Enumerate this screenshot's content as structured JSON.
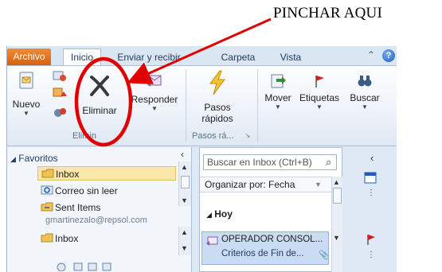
{
  "annotation": {
    "text": "PINCHAR AQUI"
  },
  "tabs": {
    "file": "Archivo",
    "home": "Inicio",
    "send_receive": "Enviar y recibir",
    "folder": "Carpeta",
    "view": "Vista",
    "help": "?"
  },
  "ribbon": {
    "new_label": "Nuevo",
    "delete_label": "Eliminar",
    "reply_label": "Responder",
    "quicksteps_label1": "Pasos",
    "quicksteps_label2": "rápidos",
    "move_label": "Mover",
    "tags_label": "Etiquetas",
    "search_label": "Buscar",
    "group_delete": "Elimin",
    "group_quicksteps": "Pasos rá..."
  },
  "nav": {
    "favorites": "Favoritos",
    "items": [
      "Inbox",
      "Correo sin leer",
      "Sent Items",
      "Inbox"
    ],
    "account": "gmartinezalo@repsol.com"
  },
  "mail": {
    "search_placeholder": "Buscar en Inbox (Ctrl+B)",
    "arrange": "Organizar por: Fecha",
    "group_today": "Hoy",
    "msg_sender": "OPERADOR CONSOL...",
    "msg_subject": "Criterios de Fin de..."
  },
  "colors": {
    "accent": "#e8731a",
    "highlight": "#e00000"
  }
}
